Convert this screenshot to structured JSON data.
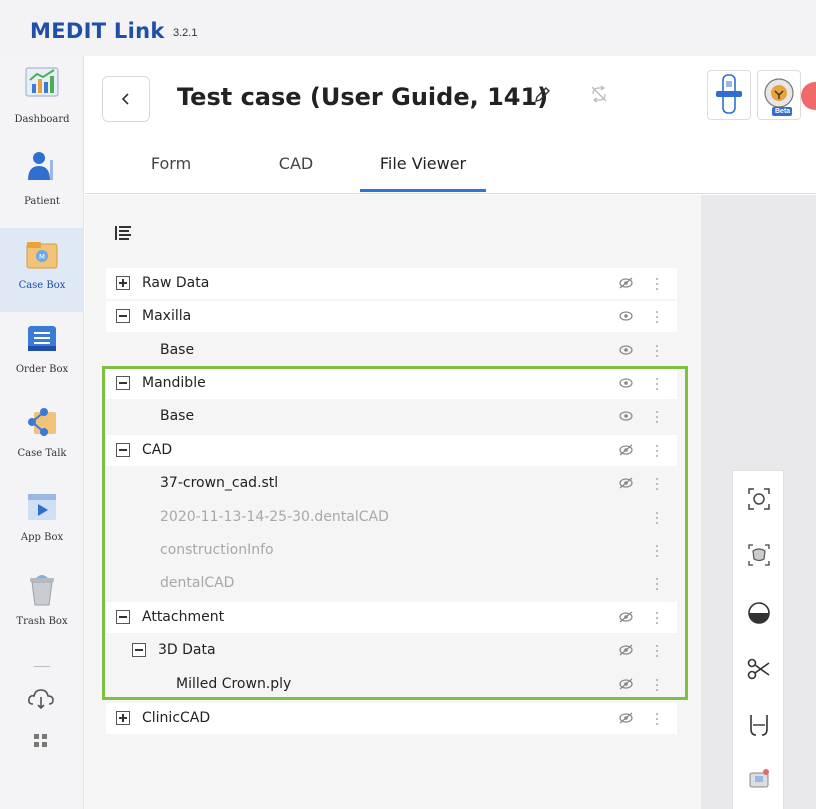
{
  "app": {
    "name": "MEDIT Link",
    "version": "3.2.1"
  },
  "nav": {
    "items": [
      {
        "label": "Dashboard"
      },
      {
        "label": "Patient"
      },
      {
        "label": "Case Box"
      },
      {
        "label": "Order Box"
      },
      {
        "label": "Case Talk"
      },
      {
        "label": "App Box"
      },
      {
        "label": "Trash Box"
      }
    ],
    "active": "Case Box"
  },
  "header": {
    "title": "Test case (User Guide, 141)",
    "beta_badge": "Beta",
    "tabs": [
      {
        "label": "Form"
      },
      {
        "label": "CAD"
      },
      {
        "label": "File Viewer"
      }
    ],
    "active_tab": "File Viewer"
  },
  "tree": {
    "rows": [
      {
        "label": "Raw Data",
        "expander": "plus",
        "eye": "hidden"
      },
      {
        "label": "Maxilla",
        "expander": "minus",
        "eye": "visible"
      },
      {
        "label": "Base",
        "eye": "visible"
      },
      {
        "label": "Mandible",
        "expander": "minus",
        "eye": "visible"
      },
      {
        "label": "Base",
        "eye": "visible"
      },
      {
        "label": "CAD",
        "expander": "minus",
        "eye": "hidden"
      },
      {
        "label": "37-crown_cad.stl",
        "eye": "hidden"
      },
      {
        "label": "2020-11-13-14-25-30.dentalCAD",
        "dimmed": true
      },
      {
        "label": "constructionInfo",
        "dimmed": true
      },
      {
        "label": "dentalCAD",
        "dimmed": true
      },
      {
        "label": "Attachment",
        "expander": "minus",
        "eye": "hidden"
      },
      {
        "label": "3D Data",
        "expander": "minus",
        "eye": "hidden"
      },
      {
        "label": "Milled Crown.ply",
        "eye": "hidden"
      },
      {
        "label": "ClinicCAD",
        "expander": "plus",
        "eye": "hidden"
      }
    ]
  },
  "colors": {
    "brand": "#1f4fa8",
    "active_tab_underline": "#2f73d9",
    "highlight_box": "#7cc242"
  }
}
